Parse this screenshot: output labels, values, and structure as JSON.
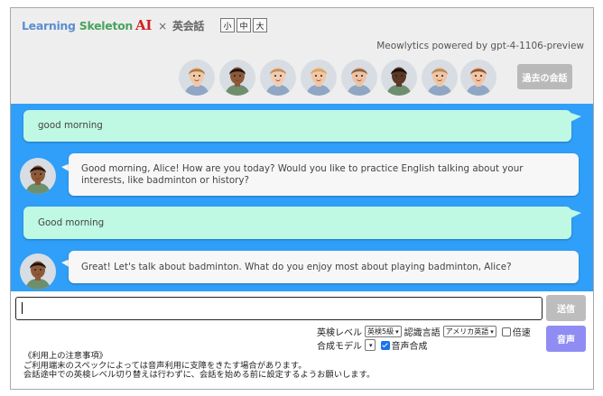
{
  "header": {
    "logo_word1": "Learning",
    "logo_word2": "Skeleton",
    "logo_ai": "AI",
    "logo_sep": "×",
    "logo_sub": "英会話",
    "font_sizes": [
      "小",
      "中",
      "大"
    ],
    "powered_by": "Meowlytics powered by gpt-4-1106-preview",
    "history_button": "過去の会話"
  },
  "avatars": [
    {
      "name": "avatar-1",
      "skin": "#f1c7a5",
      "hair": "#ad7b48"
    },
    {
      "name": "avatar-2",
      "skin": "#8d5a39",
      "hair": "#1e120c"
    },
    {
      "name": "avatar-3",
      "skin": "#f3cbb0",
      "hair": "#c09060"
    },
    {
      "name": "avatar-4",
      "skin": "#f2c6a4",
      "hair": "#d4a866"
    },
    {
      "name": "avatar-5",
      "skin": "#eec1a0",
      "hair": "#8a6346"
    },
    {
      "name": "avatar-6",
      "skin": "#5b3826",
      "hair": "#1a0f0a"
    },
    {
      "name": "avatar-7",
      "skin": "#f0c4a1",
      "hair": "#b38a5e"
    },
    {
      "name": "avatar-8",
      "skin": "#f2c3a5",
      "hair": "#8f5630"
    }
  ],
  "messages": [
    {
      "role": "user",
      "text": "good morning"
    },
    {
      "role": "bot",
      "text": "Good morning, Alice! How are you today? Would you like to practice English talking about your interests, like badminton or history?"
    },
    {
      "role": "user",
      "text": "Good morning"
    },
    {
      "role": "bot",
      "text": "Great! Let's talk about badminton. What do you enjoy most about playing badminton, Alice?"
    }
  ],
  "input": {
    "value": "",
    "placeholder": ""
  },
  "send_button": "送信",
  "voice_button": "音声",
  "options": {
    "eiken_label": "英検レベル",
    "eiken_value": "英検5級",
    "recog_label": "認識言語",
    "recog_value": "アメリカ英語",
    "speed_label": "倍速",
    "speed_checked": false,
    "synth_label": "合成モデル",
    "synth_value": "",
    "voice_synth_label": "音声合成",
    "voice_synth_checked": true
  },
  "notes": {
    "title": "《利用上の注意事項》",
    "line1": "ご利用端末のスペックによっては音声利用に支障をきたす場合があります。",
    "line2": "会話途中での英検レベル切り替えは行わずに、会話を始める前に設定するようお願いします。"
  },
  "colors": {
    "chat_bg": "#2f9ff9",
    "user_bubble": "#bff8e3",
    "bot_bubble": "#f7f7f7",
    "send_button": "#bdbdbd",
    "voice_button": "#8f8df4"
  }
}
